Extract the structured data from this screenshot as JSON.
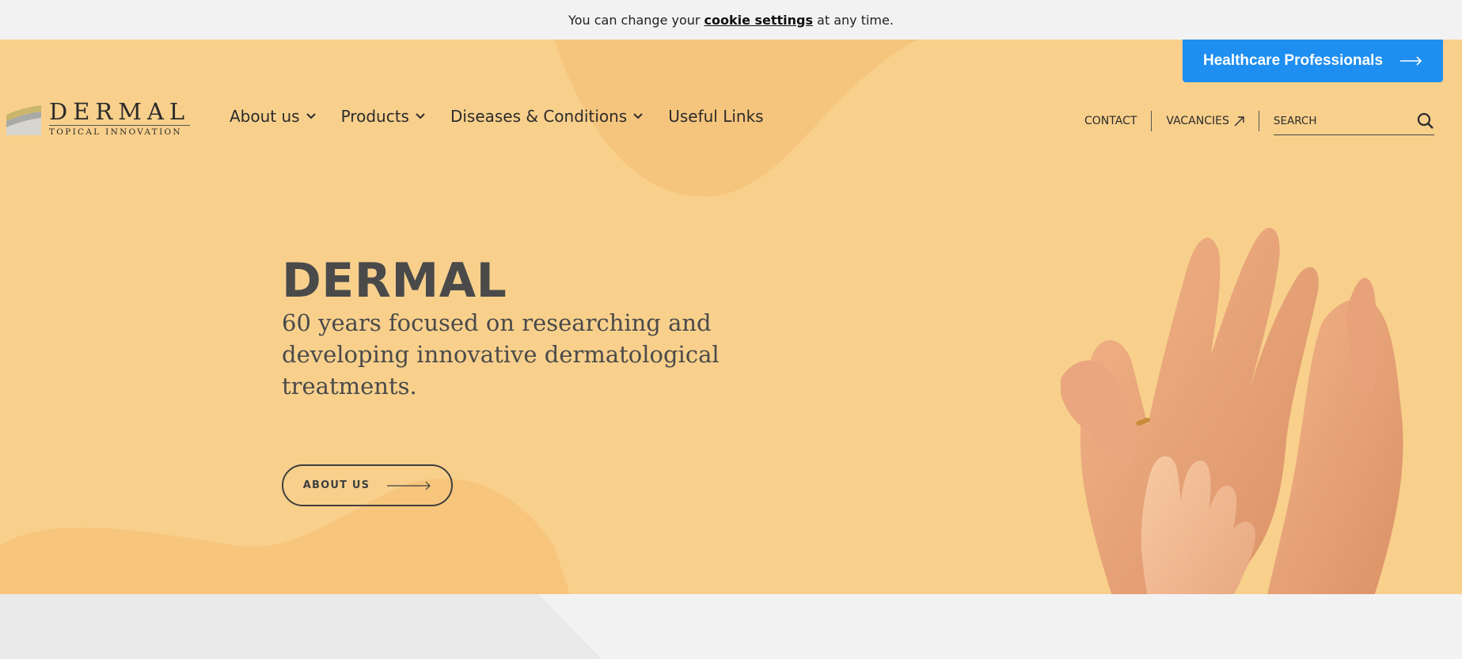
{
  "cookie_bar": {
    "prefix": "You can change your",
    "link": "cookie settings",
    "suffix": "at any time."
  },
  "header": {
    "hcp_button": "Healthcare Professionals",
    "logo": {
      "word": "DERMAL",
      "tagline": "TOPICAL INNOVATION"
    },
    "nav": [
      {
        "label": "About us",
        "has_dropdown": true
      },
      {
        "label": "Products",
        "has_dropdown": true
      },
      {
        "label": "Diseases & Conditions",
        "has_dropdown": true
      },
      {
        "label": "Useful Links",
        "has_dropdown": false
      }
    ],
    "utility": {
      "contact": "CONTACT",
      "vacancies": "VACANCIES",
      "search_placeholder": "SEARCH"
    }
  },
  "hero": {
    "title": "DERMAL",
    "subtitle": "60 years focused on researching and developing innovative dermatological treatments.",
    "cta": "ABOUT US"
  },
  "colors": {
    "hero_bg": "#f8d08c",
    "hcp_button": "#1f8ef1",
    "text_dark": "#4a4a4a",
    "page_bg": "#f2f2f2"
  },
  "icons": [
    "arrow-right-icon",
    "chevron-down-icon",
    "external-link-icon",
    "search-icon",
    "logo-mark-icon"
  ]
}
